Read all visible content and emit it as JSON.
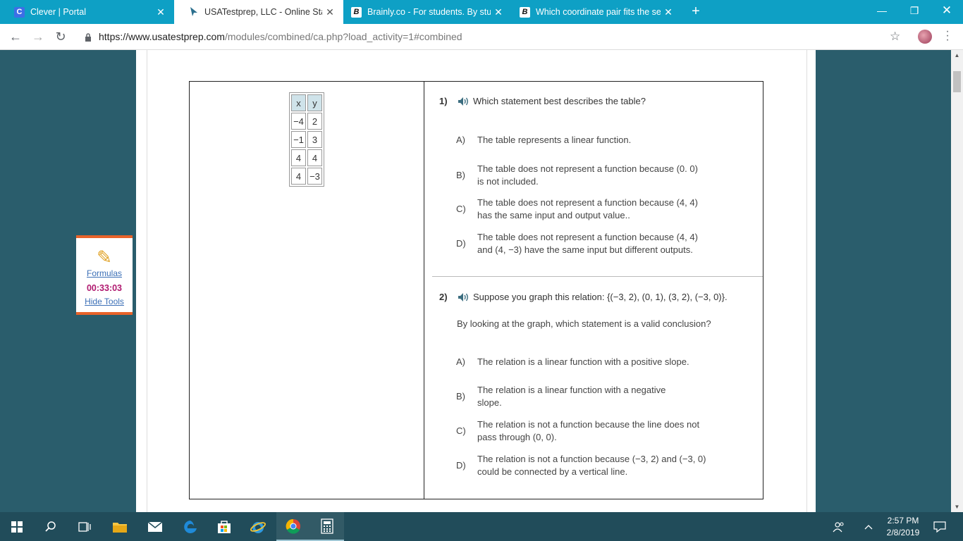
{
  "browser": {
    "tabs": [
      {
        "title": "Clever | Portal",
        "favicon": "C",
        "active": false
      },
      {
        "title": "USATestprep, LLC - Online State-",
        "favicon": "cursor",
        "active": true
      },
      {
        "title": "Brainly.co - For students. By stud",
        "favicon": "B",
        "active": false
      },
      {
        "title": "Which coordinate pair fits the se",
        "favicon": "B",
        "active": false
      }
    ],
    "url_host": "https://www.usatestprep.com",
    "url_path": "/modules/combined/ca.php?load_activity=1#combined",
    "colors": {
      "tabstrip": "#0ea0c5",
      "page_bg": "#2a5d6c"
    }
  },
  "table": {
    "headers": [
      "x",
      "y"
    ],
    "rows": [
      [
        "−4",
        "2"
      ],
      [
        "−1",
        "3"
      ],
      [
        "4",
        "4"
      ],
      [
        "4",
        "−3"
      ]
    ]
  },
  "questions": [
    {
      "number": "1)",
      "prompt": "Which statement best describes the table?",
      "choices": [
        {
          "letter": "A)",
          "text": "The table represents a linear function."
        },
        {
          "letter": "B)",
          "text": "The table does not represent a function because (0. 0) is not included."
        },
        {
          "letter": "C)",
          "text": "The table does not represent a function because (4, 4) has the same input and output value.."
        },
        {
          "letter": "D)",
          "text": "The table does not represent a function because (4, 4) and (4, −3) have the same input but different outputs."
        }
      ]
    },
    {
      "number": "2)",
      "prompt": "Suppose you graph this relation: {(−3, 2), (0, 1), (3, 2), (−3, 0)}.",
      "subprompt": "By looking at the graph, which statement is a valid conclusion?",
      "choices": [
        {
          "letter": "A)",
          "text": "The relation is a linear function with a positive slope."
        },
        {
          "letter": "B)",
          "text": "The relation is a linear function with a negative slope."
        },
        {
          "letter": "C)",
          "text": "The relation is not a function because the line does not pass through (0, 0)."
        },
        {
          "letter": "D)",
          "text": "The relation is not a function because (−3, 2) and (−3, 0) could be connected by a vertical line."
        }
      ]
    }
  ],
  "tools": {
    "formulas_label": "Formulas",
    "timer": "00:33:03",
    "hide_label": "Hide Tools"
  },
  "taskbar": {
    "time": "2:57 PM",
    "date": "2/8/2019"
  }
}
